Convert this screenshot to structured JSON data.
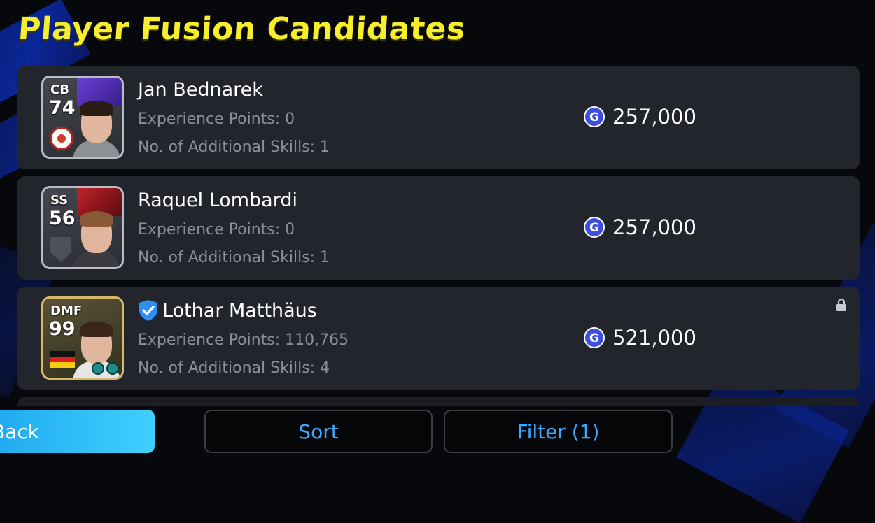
{
  "title": "Player Fusion Candidates",
  "players": [
    {
      "position": "CB",
      "rating": "74",
      "name": "Jan Bednarek",
      "experience": "Experience Points: 0",
      "skills": "No. of Additional Skills: 1",
      "price": "257,000",
      "verified": false,
      "locked": false,
      "card_style": "standard",
      "accent_color": "#6a3fd6",
      "emblem": "club-crest",
      "hair_color": "#2a1c14",
      "kit_color": "#8d9196"
    },
    {
      "position": "SS",
      "rating": "56",
      "name": "Raquel Lombardi",
      "experience": "Experience Points: 0",
      "skills": "No. of Additional Skills: 1",
      "price": "257,000",
      "verified": false,
      "locked": false,
      "card_style": "standard",
      "accent_color": "#c0222a",
      "emblem": "club-shield",
      "hair_color": "#8a5a36",
      "kit_color": "#3a3c42"
    },
    {
      "position": "DMF",
      "rating": "99",
      "name": "Lothar Matthäus",
      "experience": "Experience Points: 110,765",
      "skills": "No. of Additional Skills: 4",
      "price": "521,000",
      "verified": true,
      "locked": true,
      "card_style": "gold",
      "accent_color": "#d8b86a",
      "emblem": "germany-flag",
      "hair_color": "#3a2618",
      "kit_color": "#e6e6e6"
    }
  ],
  "buttons": {
    "back": "Back",
    "sort": "Sort",
    "filter": "Filter (1)"
  },
  "colors": {
    "title": "#f7ee2c",
    "card": "#23252c",
    "detail_text": "#8d8f96",
    "accent_blue": "#3ba9ff",
    "back_button": "#2fbdf7",
    "gp_icon": "#3d4ee0"
  },
  "icons": {
    "currency": "gp-coin-icon",
    "verified": "verified-shield-icon",
    "lock": "lock-icon"
  }
}
